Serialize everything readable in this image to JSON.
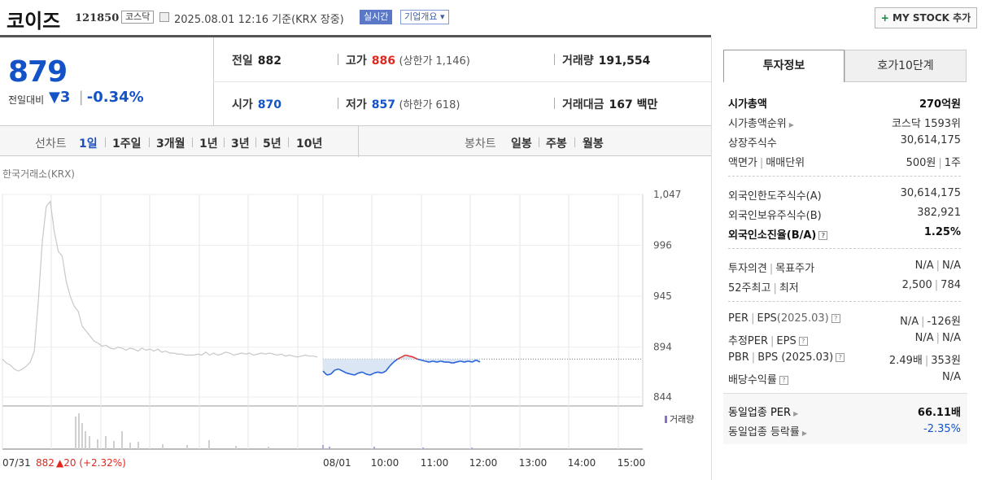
{
  "header": {
    "name": "코이즈",
    "code": "121850",
    "market": "코스닥",
    "datetime": "2025.08.01 12:16  기준(KRX 장중)",
    "realtime": "실시간",
    "company_info": "기업개요 ▾",
    "mystock_plus": "+",
    "mystock_label": " MY STOCK 추가"
  },
  "quote": {
    "price": "879",
    "change_label": "전일대비",
    "change_arrow": "▼",
    "change_value": "3",
    "change_pct": "-0.34%"
  },
  "stats": {
    "prev_label": "전일",
    "prev_value": "882",
    "high_label": "고가",
    "high_value": "886",
    "upper_text": "(상한가 1,146)",
    "volume_label": "거래량",
    "volume_value": "191,554",
    "open_label": "시가",
    "open_value": "870",
    "low_label": "저가",
    "low_value": "857",
    "lower_text": "(하한가 618)",
    "amount_label": "거래대금",
    "amount_value": "167 백만"
  },
  "tabs": {
    "line_label": "선차트",
    "line_periods": [
      "1일",
      "1주일",
      "3개월",
      "1년",
      "3년",
      "5년",
      "10년"
    ],
    "active": "1일",
    "candle_label": "봉차트",
    "candle_periods": [
      "일봉",
      "주봉",
      "월봉"
    ]
  },
  "chart": {
    "exchange": "한국거래소(KRX)",
    "volume_legend": "거래량",
    "prev_date": "07/31",
    "prev_close": "882",
    "prev_change": "▲20 (+2.32%)",
    "colors": {
      "prev_line": "#c8c8c8",
      "up": "#e53935",
      "down": "#2b63d8",
      "fill": "#dbe6f5"
    }
  },
  "chart_data": {
    "type": "line",
    "title": "",
    "ylim": [
      844,
      1047
    ],
    "y_ticks": [
      "1,047",
      "996",
      "945",
      "894",
      "844"
    ],
    "x_ticks": [
      "07/31",
      "08/01",
      "10:00",
      "11:00",
      "12:00",
      "13:00",
      "14:00",
      "15:00"
    ],
    "reference_price": 882,
    "series": [
      {
        "values": [
          882,
          878,
          876,
          872,
          870,
          872,
          875,
          879,
          890,
          940,
          1000,
          1035,
          1040,
          1010,
          990,
          985,
          960,
          945,
          935,
          930,
          915,
          910,
          905,
          900,
          898,
          895,
          896,
          893,
          892,
          894,
          893,
          891,
          893,
          892,
          890,
          893,
          891,
          892,
          890,
          892,
          889,
          890,
          888,
          888,
          887,
          887,
          886,
          886,
          886,
          887,
          886,
          889,
          886,
          888,
          886,
          887,
          889,
          888,
          886,
          887,
          888,
          887,
          888,
          886,
          887,
          888,
          887,
          888,
          887,
          886,
          887,
          885,
          886,
          885,
          884,
          885,
          886,
          885,
          885,
          884
        ]
      },
      {
        "values": [
          870,
          866,
          867,
          871,
          872,
          870,
          868,
          867,
          866,
          868,
          869,
          867,
          866,
          868,
          869,
          868,
          870,
          875,
          879,
          882,
          884,
          886,
          885,
          884,
          882,
          881,
          880,
          879,
          880,
          879,
          880,
          879,
          879,
          878,
          879,
          880,
          879,
          880,
          879,
          881,
          879
        ]
      }
    ]
  },
  "panel": {
    "tab_invest": "투자정보",
    "tab_ask": "호가10단계",
    "market_cap_label": "시가총액",
    "market_cap": "270억원",
    "cap_rank_label": "시가총액순위",
    "cap_rank": "코스닥 1593위",
    "shares_label": "상장주식수",
    "shares": "30,614,175",
    "face_label": "액면가",
    "trade_unit_label": "매매단위",
    "face_value": "500원",
    "trade_unit": "1주",
    "foreign_limit_label": "외국인한도주식수(A)",
    "foreign_limit": "30,614,175",
    "foreign_hold_label": "외국인보유주식수(B)",
    "foreign_hold": "382,921",
    "foreign_ratio_label": "외국인소진율(B/A)",
    "foreign_ratio": "1.25%",
    "opinion_label": "투자의견",
    "target_label": "목표주가",
    "opinion": "N/A",
    "target": "N/A",
    "w52_high_label": "52주최고",
    "w52_low_label": "최저",
    "w52_high": "2,500",
    "w52_low": "784",
    "per_label": "PER",
    "eps_label": "EPS",
    "eps_period": "(2025.03)",
    "per": "N/A",
    "eps": "-126원",
    "fper_label": "추정PER",
    "feps_label": "EPS",
    "fper": "N/A",
    "feps": "N/A",
    "pbr_label": "PBR",
    "bps_label": "BPS (2025.03)",
    "pbr": "2.49배",
    "bps": "353원",
    "div_label": "배당수익률",
    "div": "N/A",
    "ind_per_label": "동일업종 PER",
    "ind_per": "66.11배",
    "ind_rate_label": "동일업종 등락률",
    "ind_rate": "-2.35%"
  }
}
